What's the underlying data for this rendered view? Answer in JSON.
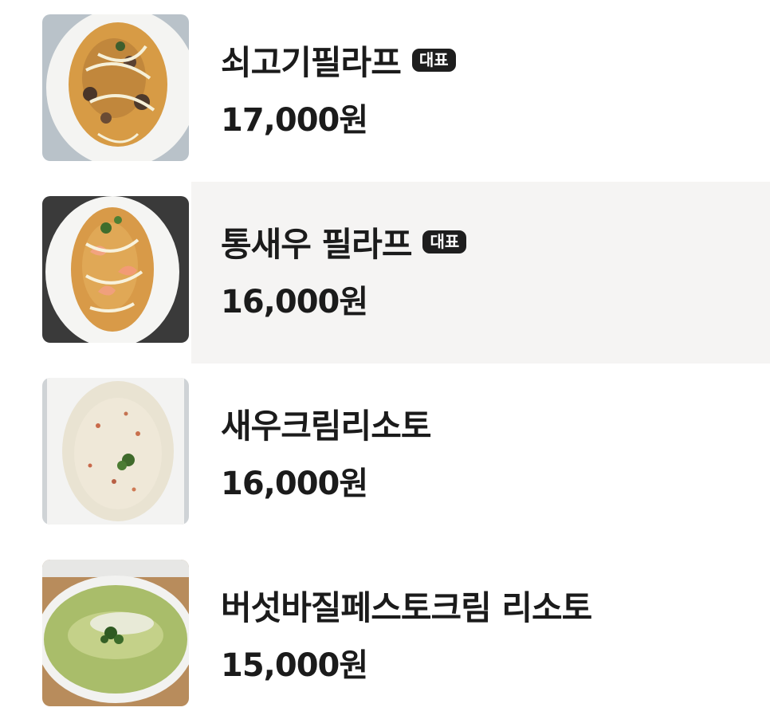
{
  "menu": {
    "items": [
      {
        "name": "쇠고기필라프",
        "badge": "대표",
        "price": "17,000원",
        "image": "beef-pilaf-photo"
      },
      {
        "name": "통새우 필라프",
        "badge": "대표",
        "price": "16,000원",
        "image": "whole-shrimp-pilaf-photo"
      },
      {
        "name": "새우크림리소토",
        "badge": "",
        "price": "16,000원",
        "image": "shrimp-cream-risotto-photo"
      },
      {
        "name": "버섯바질페스토크림 리소토",
        "badge": "",
        "price": "15,000원",
        "image": "mushroom-basil-pesto-cream-risotto-photo"
      }
    ]
  },
  "colors": {
    "badge_bg": "#1e1e1e",
    "highlight_row": "#f5f4f3",
    "text": "#1b1b1b"
  }
}
